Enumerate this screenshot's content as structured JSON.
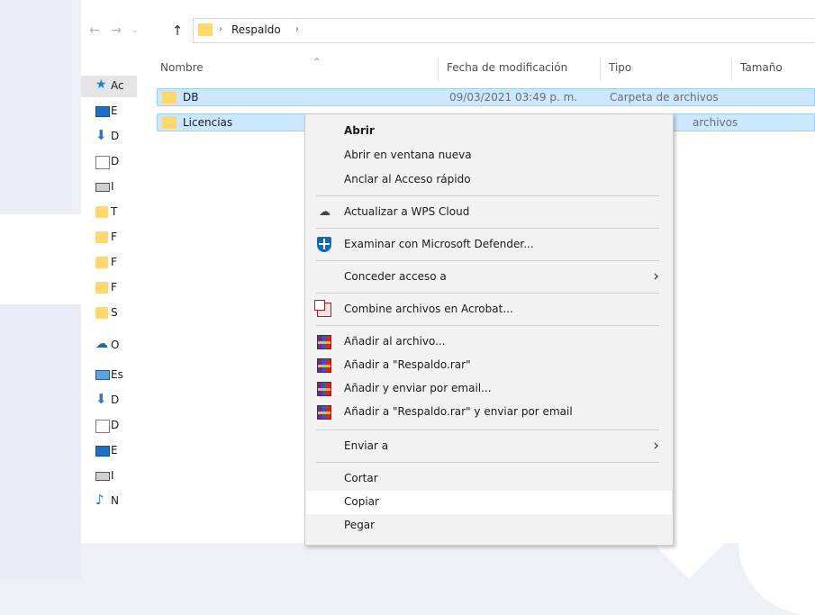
{
  "address": {
    "crumb": "Respaldo",
    "separator": "›"
  },
  "nav": {
    "back_icon": "←",
    "forward_icon": "→",
    "recent_icon": "⌄",
    "up_icon": "↑"
  },
  "navpane": {
    "items": [
      {
        "icon": "star-icon",
        "text": "Ac"
      },
      {
        "icon": "desktop-icon",
        "text": "E"
      },
      {
        "icon": "download-icon",
        "text": "D"
      },
      {
        "icon": "document-icon",
        "text": "D"
      },
      {
        "icon": "image-icon",
        "text": "I"
      },
      {
        "icon": "folder-icon",
        "text": "T"
      },
      {
        "icon": "folder-icon",
        "text": "F"
      },
      {
        "icon": "folder-icon",
        "text": "F"
      },
      {
        "icon": "folder-icon",
        "text": "F"
      },
      {
        "icon": "folder-icon",
        "text": "S"
      },
      {
        "icon": "onedrive-icon",
        "text": "O"
      },
      {
        "icon": "computer-icon",
        "text": "Es"
      },
      {
        "icon": "download-icon",
        "text": "D"
      },
      {
        "icon": "document-icon",
        "text": "D"
      },
      {
        "icon": "desktop-icon",
        "text": "E"
      },
      {
        "icon": "image-icon",
        "text": "I"
      },
      {
        "icon": "music-icon",
        "text": "N"
      }
    ]
  },
  "columns": {
    "name": "Nombre",
    "date": "Fecha de modificación",
    "type": "Tipo",
    "size": "Tamaño",
    "sort_icon": "^"
  },
  "files": [
    {
      "name": "DB",
      "date": "09/03/2021 03:49 p. m.",
      "type": "Carpeta de archivos"
    },
    {
      "name": "Licencias",
      "date": "",
      "type": "archivos"
    }
  ],
  "context_menu": {
    "open": "Abrir",
    "open_new_window": "Abrir en ventana nueva",
    "pin_quick_access": "Anclar al Acceso rápido",
    "wps_cloud": "Actualizar a WPS Cloud",
    "defender": "Examinar con Microsoft Defender...",
    "give_access": "Conceder acceso a",
    "acrobat": "Combine archivos en Acrobat...",
    "rar_add": "Añadir al archivo...",
    "rar_add_named": "Añadir a \"Respaldo.rar\"",
    "rar_add_email": "Añadir y enviar por email...",
    "rar_add_named_email": "Añadir a \"Respaldo.rar\" y enviar por email",
    "send_to": "Enviar a",
    "cut": "Cortar",
    "copy": "Copiar",
    "paste": "Pegar",
    "submenu_arrow": "›",
    "cloud_glyph": "☁"
  },
  "icon_glyphs": {
    "star": "★",
    "download": "⬇",
    "cloud": "☁",
    "music": "♪"
  }
}
